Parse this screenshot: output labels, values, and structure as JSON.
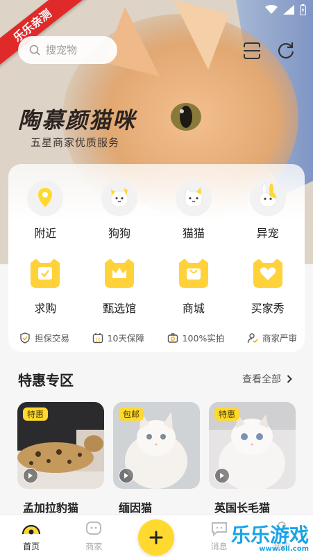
{
  "ribbon": "乐乐亲测",
  "search": {
    "placeholder": "搜宠物"
  },
  "hero": {
    "title": "陶慕颜猫咪",
    "subtitle": "五星商家优质服务"
  },
  "categories": [
    {
      "label": "附近",
      "icon": "location-pin-icon"
    },
    {
      "label": "狗狗",
      "icon": "dog-icon"
    },
    {
      "label": "猫猫",
      "icon": "cat-icon"
    },
    {
      "label": "异宠",
      "icon": "rabbit-icon"
    },
    {
      "label": "求购",
      "icon": "request-icon"
    },
    {
      "label": "甄选馆",
      "icon": "crown-icon"
    },
    {
      "label": "商城",
      "icon": "shop-bag-icon"
    },
    {
      "label": "买家秀",
      "icon": "heart-icon"
    }
  ],
  "guarantees": [
    {
      "label": "担保交易",
      "icon": "shield-check-icon"
    },
    {
      "label": "10天保障",
      "icon": "calendar-10-icon"
    },
    {
      "label": "100%实拍",
      "icon": "camera-icon"
    },
    {
      "label": "商家严审",
      "icon": "person-check-icon"
    }
  ],
  "special": {
    "title": "特惠专区",
    "more": "查看全部",
    "items": [
      {
        "badge": "特惠",
        "name": "孟加拉豹猫"
      },
      {
        "badge": "包邮",
        "name": "缅因猫"
      },
      {
        "badge": "特惠",
        "name": "英国长毛猫"
      }
    ]
  },
  "tabbar": {
    "tabs": [
      {
        "label": "首页"
      },
      {
        "label": "商家"
      },
      {
        "label": ""
      },
      {
        "label": "消息"
      },
      {
        "label": "我的"
      }
    ]
  },
  "watermark": {
    "main": "乐乐游戏",
    "url": "www.6ll.com"
  },
  "colors": {
    "accent": "#ffd92e",
    "ribbon": "#e02a2a"
  }
}
